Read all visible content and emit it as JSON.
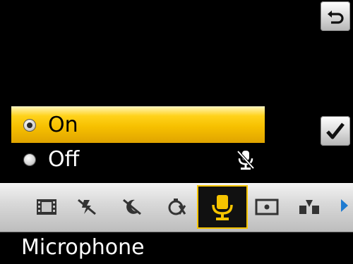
{
  "options": [
    {
      "label": "On",
      "selected": true
    },
    {
      "label": "Off",
      "selected": false
    }
  ],
  "toolbar": {
    "items": [
      {
        "icon": "film-icon"
      },
      {
        "icon": "flash-off-icon"
      },
      {
        "icon": "night-mode-icon"
      },
      {
        "icon": "self-timer-off-icon"
      },
      {
        "icon": "microphone-icon",
        "active": true
      },
      {
        "icon": "focus-spot-icon"
      },
      {
        "icon": "stabilizer-icon"
      }
    ]
  },
  "footer": {
    "title": "Microphone"
  },
  "colors": {
    "accent": "#f6c000",
    "arrow": "#1e7bd1"
  }
}
